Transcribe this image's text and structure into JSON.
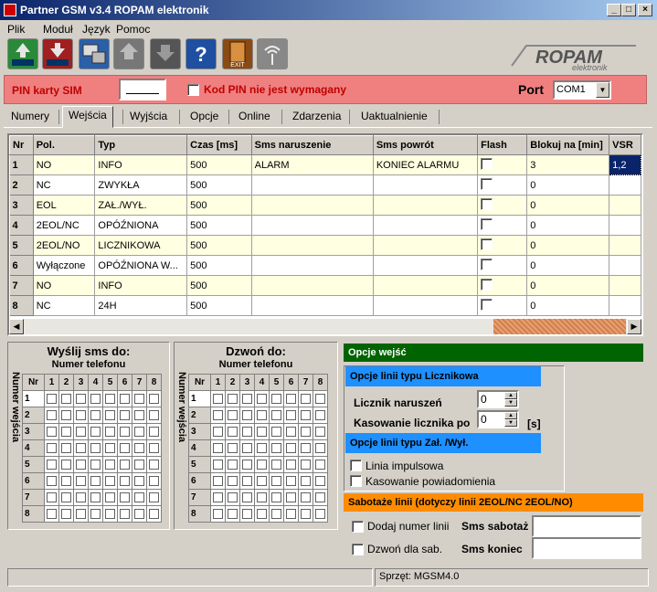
{
  "window": {
    "title": "Partner GSM v3.4 ROPAM elektronik"
  },
  "menu": [
    "Plik",
    "Moduł",
    "Język",
    "Pomoc"
  ],
  "toolbar": {
    "exit_label": "EXIT"
  },
  "logo": {
    "brand": "ROPAM",
    "sub": "elektronik"
  },
  "pinbar": {
    "pin_label": "PIN karty SIM",
    "pin_value": "",
    "pin_not_required": "Kod PIN nie jest wymagany",
    "port_label": "Port",
    "port_value": "COM1"
  },
  "tabs": [
    "Numery",
    "Wejścia",
    "Wyjścia",
    "Opcje",
    "Online",
    "Zdarzenia",
    "Uaktualnienie"
  ],
  "tabs_selected": "Wejścia",
  "grid": {
    "columns": [
      "Nr",
      "Pol.",
      "Typ",
      "Czas [ms]",
      "Sms naruszenie",
      "Sms powrót",
      "Flash",
      "Blokuj na [min]",
      "VSR"
    ],
    "rows": [
      [
        "1",
        "NO",
        "INFO",
        "500",
        "ALARM",
        "KONIEC ALARMU",
        "",
        "3",
        "1,2"
      ],
      [
        "2",
        "NC",
        "ZWYKŁA",
        "500",
        "",
        "",
        "",
        "0",
        ""
      ],
      [
        "3",
        "EOL",
        "ZAŁ./WYŁ.",
        "500",
        "",
        "",
        "",
        "0",
        ""
      ],
      [
        "4",
        "2EOL/NC",
        "OPÓŹNIONA",
        "500",
        "",
        "",
        "",
        "0",
        ""
      ],
      [
        "5",
        "2EOL/NO",
        "LICZNIKOWA",
        "500",
        "",
        "",
        "",
        "0",
        ""
      ],
      [
        "6",
        "Wyłączone",
        "OPÓŹNIONA W...",
        "500",
        "",
        "",
        "",
        "0",
        ""
      ],
      [
        "7",
        "NO",
        "INFO",
        "500",
        "",
        "",
        "",
        "0",
        ""
      ],
      [
        "8",
        "NC",
        "24H",
        "500",
        "",
        "",
        "",
        "0",
        ""
      ]
    ]
  },
  "sms_panel": {
    "title": "Wyślij sms do:",
    "subtitle": "Numer telefonu",
    "side_label": "Numer wejścia",
    "nr": "Nr"
  },
  "call_panel": {
    "title": "Dzwoń do:",
    "subtitle": "Numer telefonu",
    "side_label": "Numer wejścia",
    "nr": "Nr"
  },
  "mini_cols": [
    "1",
    "2",
    "3",
    "4",
    "5",
    "6",
    "7",
    "8"
  ],
  "options": {
    "header": "Opcje wejść",
    "counter_header": "Opcje linii typu Licznikowa",
    "counter_label": "Licznik naruszeń",
    "counter_value": "0",
    "reset_label": "Kasowanie licznika po",
    "reset_value": "0",
    "reset_unit": "[s]",
    "onoff_header": "Opcje linii typu Zał. /Wył.",
    "impulse_label": "Linia impulsowa",
    "notify_reset_label": "Kasowanie powiadomienia",
    "sabotage_header": "Sabotaże linii (dotyczy linii 2EOL/NC 2EOL/NO)",
    "add_number_label": "Dodaj numer linii",
    "sms_sab_label": "Sms sabotaż",
    "call_sab_label": "Dzwoń dla sab.",
    "sms_end_label": "Sms koniec"
  },
  "colors": {
    "green": "#006400",
    "blue": "#1e90ff",
    "orange": "#ff8c00",
    "pink": "#f08080"
  },
  "status": {
    "left": "",
    "hardware": "Sprzęt: MGSM4.0"
  }
}
